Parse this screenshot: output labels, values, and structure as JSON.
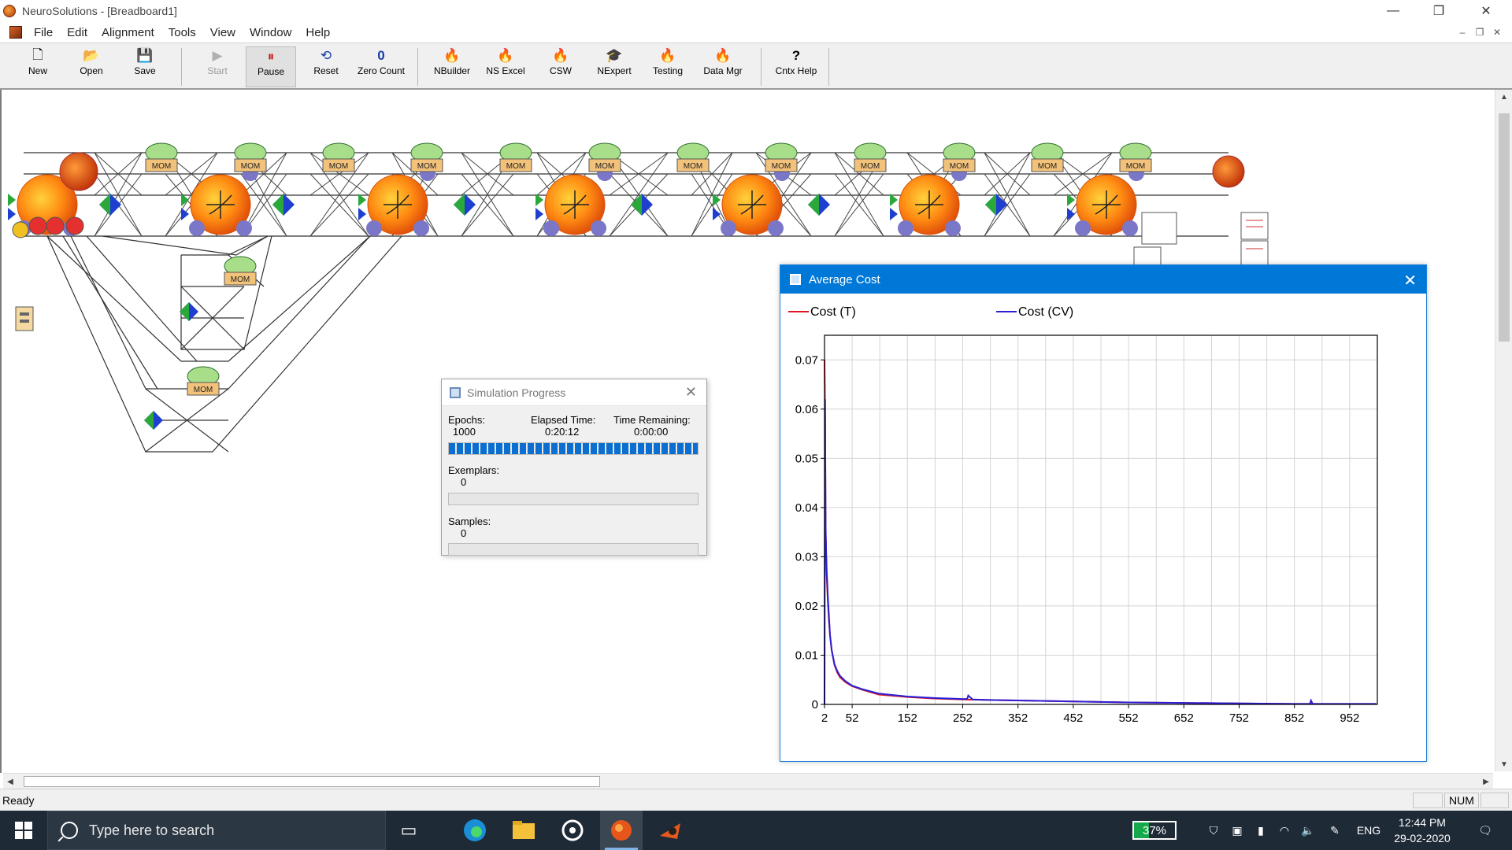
{
  "app": {
    "title": "NeuroSolutions - [Breadboard1]",
    "window_controls": [
      "—",
      "❐",
      "✕"
    ],
    "mdi_controls": [
      "–",
      "❐",
      "✕"
    ]
  },
  "menu": [
    "File",
    "Edit",
    "Alignment",
    "Tools",
    "View",
    "Window",
    "Help"
  ],
  "toolbar": {
    "buttons": [
      {
        "label": "New",
        "icon": "new-doc-icon",
        "glyph": "🗋"
      },
      {
        "label": "Open",
        "icon": "open-folder-icon",
        "glyph": "📂"
      },
      {
        "label": "Save",
        "icon": "floppy-icon",
        "glyph": "💾"
      },
      {
        "label": "Start",
        "icon": "play-icon",
        "glyph": "▶"
      },
      {
        "label": "Pause",
        "icon": "pause-icon",
        "glyph": "⏸"
      },
      {
        "label": "Reset",
        "icon": "reset-icon",
        "glyph": "⟲"
      },
      {
        "label": "Zero Count",
        "icon": "zero-icon",
        "glyph": "0"
      },
      {
        "label": "NBuilder",
        "icon": "nbuilder-icon",
        "glyph": "🔥"
      },
      {
        "label": "NS Excel",
        "icon": "excel-icon",
        "glyph": "🔥"
      },
      {
        "label": "CSW",
        "icon": "csw-icon",
        "glyph": "🔥"
      },
      {
        "label": "NExpert",
        "icon": "nexpert-icon",
        "glyph": "🎓"
      },
      {
        "label": "Testing",
        "icon": "testing-icon",
        "glyph": "🔥"
      },
      {
        "label": "Data Mgr",
        "icon": "datamgr-icon",
        "glyph": "🔥"
      },
      {
        "label": "Cntx Help",
        "icon": "context-help-icon",
        "glyph": "?"
      }
    ]
  },
  "network": {
    "momentum_label": "MOM"
  },
  "cost_window": {
    "title": "Average Cost",
    "close": "✕"
  },
  "chart_data": {
    "type": "line",
    "title": "",
    "legend_position": "top",
    "series": [
      {
        "name": "Cost (T)",
        "color": "#e0161e",
        "x": [
          2,
          3,
          4,
          5,
          6,
          8,
          10,
          12,
          15,
          20,
          25,
          30,
          40,
          52,
          70,
          100,
          152,
          200,
          252,
          300,
          352,
          452,
          552,
          652,
          752,
          852,
          952,
          1000
        ],
        "y": [
          0.07,
          0.06,
          0.035,
          0.03,
          0.026,
          0.021,
          0.017,
          0.014,
          0.011,
          0.008,
          0.0065,
          0.0055,
          0.0045,
          0.0037,
          0.003,
          0.002,
          0.0015,
          0.0012,
          0.001,
          0.0009,
          0.0008,
          0.0006,
          0.0004,
          0.0003,
          0.0002,
          0.0001,
          0.0001,
          0.0001
        ]
      },
      {
        "name": "Cost (CV)",
        "color": "#2b1fd6",
        "x": [
          2,
          3,
          4,
          5,
          6,
          8,
          10,
          12,
          15,
          20,
          25,
          30,
          40,
          52,
          70,
          100,
          152,
          200,
          252,
          260,
          262,
          270,
          300,
          352,
          452,
          552,
          652,
          752,
          852,
          880,
          882,
          885,
          952,
          1000
        ],
        "y": [
          0.0,
          0.062,
          0.036,
          0.031,
          0.027,
          0.022,
          0.018,
          0.014,
          0.011,
          0.0082,
          0.0068,
          0.0058,
          0.0047,
          0.0038,
          0.0031,
          0.0022,
          0.0016,
          0.0013,
          0.0011,
          0.0011,
          0.0018,
          0.001,
          0.0009,
          0.0008,
          0.0006,
          0.0004,
          0.0003,
          0.0002,
          0.0001,
          0.0001,
          0.0008,
          0.0001,
          0.0001,
          0.0001
        ]
      }
    ],
    "xlim": [
      2,
      1002
    ],
    "ylim": [
      0,
      0.075
    ],
    "x_ticks": [
      2,
      52,
      152,
      252,
      352,
      452,
      552,
      652,
      752,
      852,
      952
    ],
    "x_grid": [
      2,
      52,
      102,
      152,
      202,
      252,
      302,
      352,
      402,
      452,
      502,
      552,
      602,
      652,
      702,
      752,
      802,
      852,
      902,
      952
    ],
    "y_ticks": [
      0,
      0.01,
      0.02,
      0.03,
      0.04,
      0.05,
      0.06,
      0.07
    ],
    "y_tick_labels": [
      "0",
      "0.01",
      "0.02",
      "0.03",
      "0.04",
      "0.05",
      "0.06",
      "0.07"
    ],
    "grid": true
  },
  "sim_progress": {
    "title": "Simulation Progress",
    "close": "✕",
    "epochs_label": "Epochs:",
    "epochs_value": "1000",
    "elapsed_label": "Elapsed Time:",
    "elapsed_value": "0:20:12",
    "remaining_label": "Time Remaining:",
    "remaining_value": "0:00:00",
    "epochs_progress": 1.0,
    "exemplars_label": "Exemplars:",
    "exemplars_value": "0",
    "exemplars_progress": 0,
    "samples_label": "Samples:",
    "samples_value": "0",
    "samples_progress": 0
  },
  "status": {
    "ready": "Ready",
    "num": "NUM"
  },
  "taskbar": {
    "search_placeholder": "Type here to search",
    "battery": "37%",
    "lang": "ENG",
    "time": "12:44 PM",
    "date": "29-02-2020",
    "apps": [
      "task-view-icon",
      "edge-icon",
      "file-explorer-icon",
      "media-icon",
      "neurosolutions-icon",
      "neurosolutions-alt-icon"
    ]
  }
}
